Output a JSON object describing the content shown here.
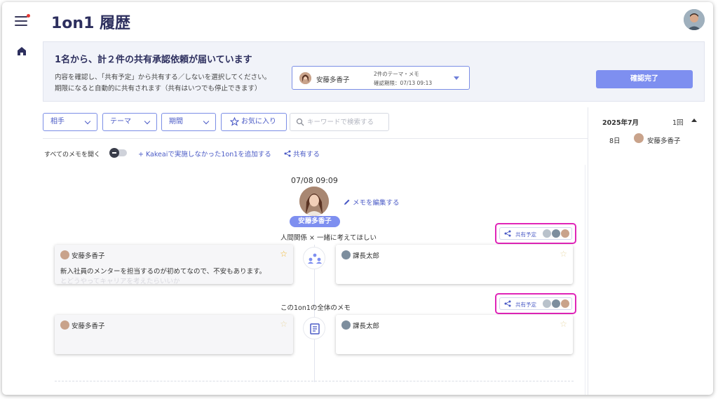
{
  "header": {
    "title": "1on1 履歴"
  },
  "banner": {
    "title": "1名から、計２件の共有承認依頼が届いています",
    "desc_line1": "内容を確認し、「共有予定」から共有する／しないを選択してください。",
    "desc_line2": "期限になると自動的に共有されます（共有はいつでも停止できます）",
    "request": {
      "name": "安藤多香子",
      "topics": "2件のテーマ・メモ",
      "deadline": "確認期限：07/13 09:13"
    },
    "confirm_label": "確認完了"
  },
  "filters": {
    "partner": "相手",
    "theme": "テーマ",
    "period": "期間",
    "favorites": "お気に入り",
    "search_placeholder": "キーワードで検索する"
  },
  "toolbar": {
    "open_all": "すべてのメモを開く",
    "add_label": "Kakeaiで実施しなかった1on1を追加する",
    "share_label": "共有する"
  },
  "meeting": {
    "datetime": "07/08 09:09",
    "partner_name": "安藤多香子",
    "edit_label": "メモを編集する",
    "share_chip_label": "共有予定",
    "sections": [
      {
        "title": "人間関係 × 一緒に考えてほしい",
        "left_name": "安藤多香子",
        "left_text": "新入社員のメンターを担当するのが初めてなので、不安もあります。",
        "left_fade": "とどうやってキャリアを考えたらいいか",
        "right_name": "課長太郎"
      },
      {
        "title": "この1on1の全体のメモ",
        "left_name": "安藤多香子",
        "right_name": "課長太郎"
      }
    ]
  },
  "right_panel": {
    "month": "2025年7月",
    "count": "1回",
    "day": "8日",
    "name": "安藤多香子"
  },
  "colors": {
    "accent": "#7e8ff0",
    "link": "#4b5bc6",
    "highlight": "#e025b8",
    "star": "#f0b429"
  }
}
